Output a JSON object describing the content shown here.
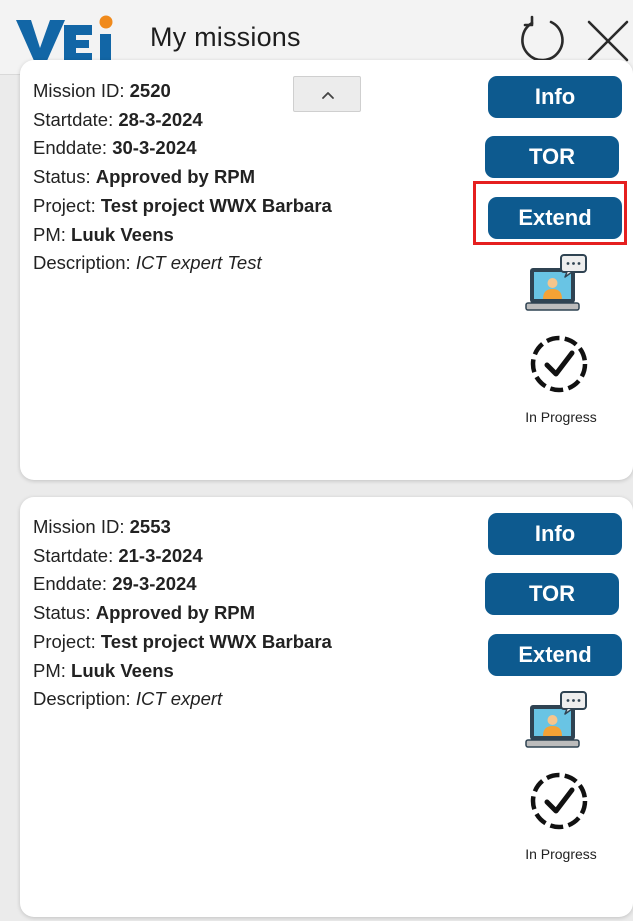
{
  "header": {
    "logo_text": "VEi",
    "title": "My missions",
    "refresh_icon": "refresh-icon",
    "close_icon": "close-icon"
  },
  "colors": {
    "primary_button": "#0d5a8f",
    "highlight_border": "#e51f1f",
    "logo_blue": "#1266a6",
    "logo_orange": "#f08a1c"
  },
  "labels": {
    "mission_id": "Mission ID:",
    "startdate": "Startdate:",
    "enddate": "Enddate:",
    "status": "Status:",
    "project": "Project:",
    "pm": "PM:",
    "description": "Description:",
    "info_button": "Info",
    "tor_button": "TOR",
    "extend_button": "Extend",
    "progress_text": "In Progress"
  },
  "missions": [
    {
      "mission_id": "2520",
      "startdate": "28-3-2024",
      "enddate": "30-3-2024",
      "status": "Approved by RPM",
      "project": "Test project WWX Barbara",
      "pm": "Luuk Veens",
      "description": "ICT expert Test",
      "highlighted_action": "Extend"
    },
    {
      "mission_id": "2553",
      "startdate": "21-3-2024",
      "enddate": "29-3-2024",
      "status": "Approved by RPM",
      "project": "Test project WWX Barbara",
      "pm": "Luuk Veens",
      "description": "ICT expert"
    }
  ]
}
